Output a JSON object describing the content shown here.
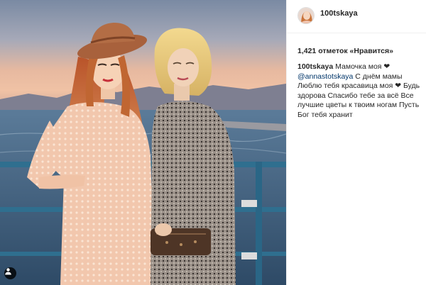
{
  "post": {
    "username": "100tskaya",
    "likes_text": "1,421 отметок «Нравится»",
    "caption": {
      "username": "100tskaya",
      "line1": "Мамочка моя ❤",
      "mention": "@annastotskaya",
      "line2": " С днём мамы",
      "line3": "Люблю тебя красавица моя    ❤ Будь здорова    Спасибо тебе за всё    Все лучшие цветы к твоим ногам    Пусть Бог тебя хранит"
    }
  },
  "icons": {
    "user_tag": "person-icon",
    "avatar": "profile-avatar"
  },
  "colors": {
    "mention": "#003569",
    "text": "#262626",
    "border": "#efefef"
  }
}
